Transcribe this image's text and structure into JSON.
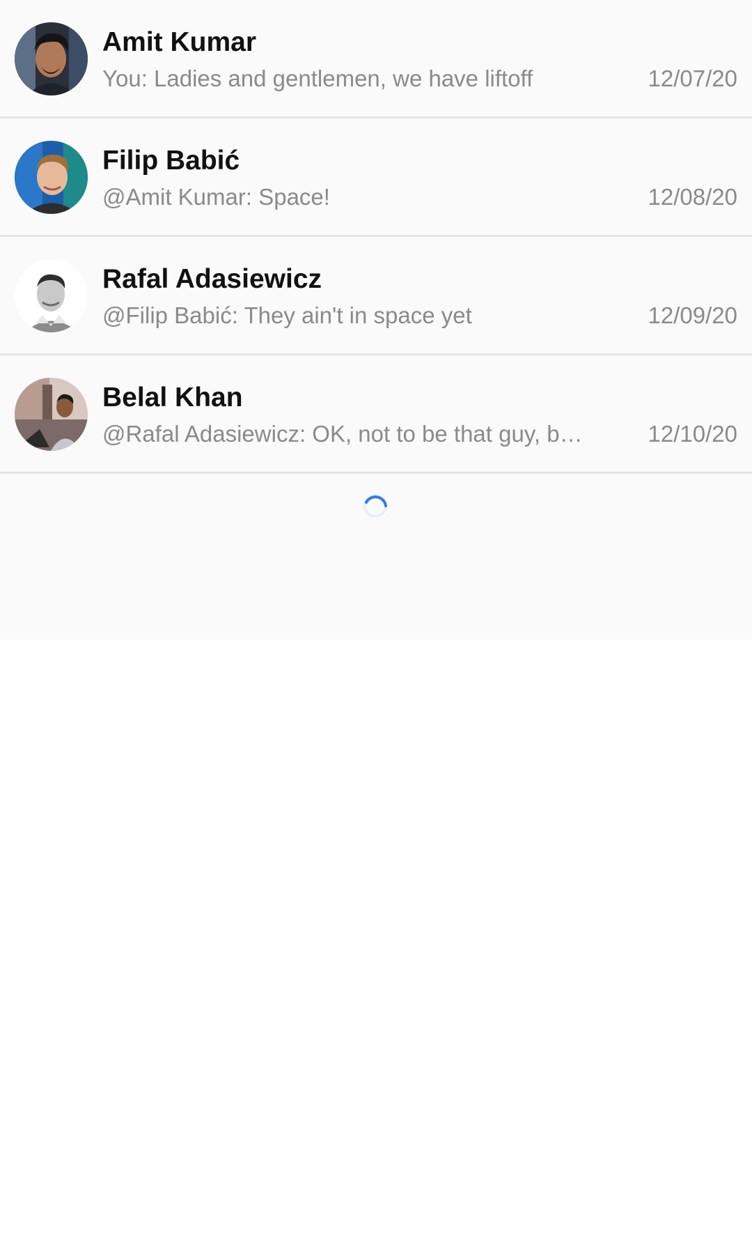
{
  "conversations": [
    {
      "name": "Amit Kumar",
      "preview": "You: Ladies and gentlemen, we have liftoff",
      "date": "12/07/20"
    },
    {
      "name": "Filip Babić",
      "preview": "@Amit Kumar: Space!",
      "date": "12/08/20"
    },
    {
      "name": "Rafal Adasiewicz",
      "preview": "@Filip Babić: They ain't in space yet",
      "date": "12/09/20"
    },
    {
      "name": "Belal Khan",
      "preview": "@Rafal Adasiewicz: OK, not to be that guy, b…",
      "date": "12/10/20"
    }
  ],
  "loading_indicator": {
    "icon": "loading-spinner-icon",
    "color": "#2f7be0"
  },
  "colors": {
    "list_background": "#fafafa",
    "divider": "#e4e4e4",
    "name_text": "#111111",
    "secondary_text": "#8a8a8a"
  }
}
